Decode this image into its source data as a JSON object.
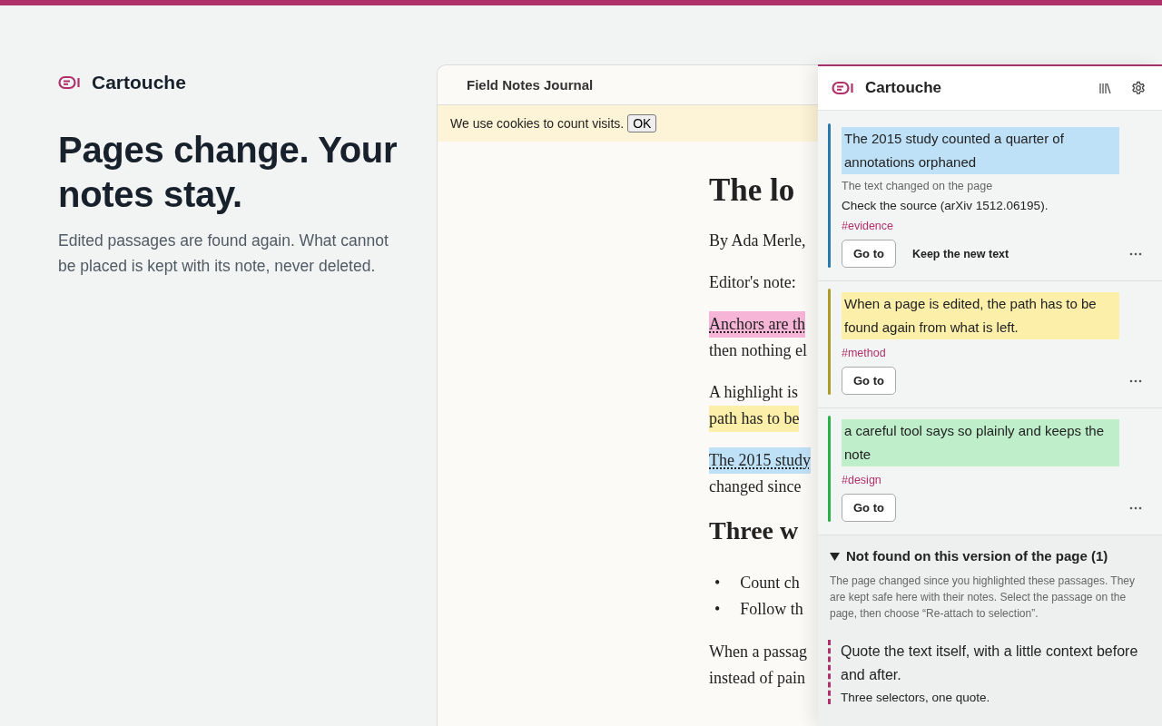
{
  "hero": {
    "brand": "Cartouche",
    "headline": "Pages change. Your notes stay.",
    "lede": "Edited passages are found again. What cannot be placed is kept with its note, never deleted."
  },
  "article_window": {
    "site_title": "Field Notes Journal",
    "cookie_banner": {
      "text": "We use cookies to count visits.",
      "button": "OK"
    },
    "blocks": [
      {
        "kind": "title",
        "text": "The lo"
      },
      {
        "kind": "para",
        "lines": [
          {
            "text": "By Ada Merle,"
          }
        ]
      },
      {
        "kind": "para",
        "lines": [
          {
            "text": "Editor's note:"
          }
        ]
      },
      {
        "kind": "para",
        "lines": [
          {
            "text": "Anchors are th",
            "color": "#f6b5d7",
            "underlined": true
          },
          {
            "text": "then nothing el"
          }
        ]
      },
      {
        "kind": "para",
        "lines": [
          {
            "text": "A highlight is"
          },
          {
            "text": "path has to be",
            "color": "#fbefaa",
            "underlined": false
          }
        ]
      },
      {
        "kind": "para",
        "lines": [
          {
            "text": "The 2015 study",
            "color": "#bfe1f7",
            "underlined": true
          },
          {
            "text": "changed since"
          }
        ]
      },
      {
        "kind": "heading",
        "text": "Three w"
      },
      {
        "kind": "list",
        "marker": "•",
        "items": [
          "Count ch",
          "Follow th"
        ]
      },
      {
        "kind": "para",
        "lines": [
          {
            "text": "When a passag"
          },
          {
            "text": "instead of pain"
          }
        ]
      }
    ]
  },
  "panel": {
    "brand": "Cartouche",
    "annotations": [
      {
        "color": "#bfe1f7",
        "quote": "The 2015 study counted a quarter of annotations orphaned",
        "status": "The text changed on the page",
        "note": "Check the source (arXiv 1512.06195).",
        "tag": "#evidence",
        "actions": [
          "Go to",
          "Keep the new text"
        ]
      },
      {
        "color": "#fbefaa",
        "quote": "When a page is edited, the path has to be found again from what is left.",
        "tag": "#method",
        "actions": [
          "Go to"
        ]
      },
      {
        "color": "#bfeeca",
        "quote": "a careful tool says so plainly and keeps the note",
        "tag": "#design",
        "actions": [
          "Go to"
        ]
      }
    ],
    "orphaned": {
      "expanded": true,
      "heading": "Not found on this version of the page (1)",
      "description": "The page changed since you highlighted these passages. They are kept safe here with their notes. Select the passage on the page, then choose “Re-attach to selection”.",
      "items": [
        {
          "quote": "Quote the text itself, with a little context before and after.",
          "note": "Three selectors, one quote."
        }
      ]
    }
  }
}
